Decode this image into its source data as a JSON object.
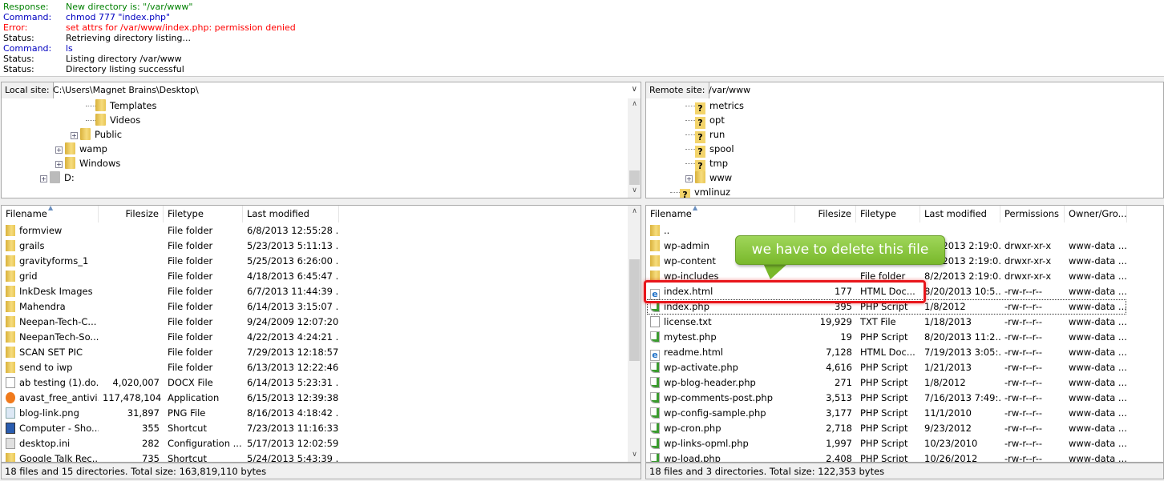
{
  "log": [
    {
      "k": "Response:",
      "v": "New directory is: \"/var/www\"",
      "color": "#008000"
    },
    {
      "k": "Command:",
      "v": "chmod 777 \"index.php\"",
      "color": "#0000c0"
    },
    {
      "k": "Error:",
      "v": "set attrs for /var/www/index.php: permission denied",
      "color": "#ff0000"
    },
    {
      "k": "Status:",
      "v": "Retrieving directory listing...",
      "color": "#000000"
    },
    {
      "k": "Command:",
      "v": "ls",
      "color": "#0000c0"
    },
    {
      "k": "Status:",
      "v": "Listing directory /var/www",
      "color": "#000000"
    },
    {
      "k": "Status:",
      "v": "Directory listing successful",
      "color": "#000000"
    }
  ],
  "local": {
    "site_label": "Local site:",
    "path": "C:\\Users\\Magnet Brains\\Desktop\\",
    "tree": [
      {
        "label": "Templates",
        "indent": 3,
        "icon": "folder",
        "expand": false
      },
      {
        "label": "Videos",
        "indent": 3,
        "icon": "video-folder",
        "expand": false
      },
      {
        "label": "Public",
        "indent": 2,
        "icon": "folder",
        "expand": true
      },
      {
        "label": "wamp",
        "indent": 1,
        "icon": "folder",
        "expand": true
      },
      {
        "label": "Windows",
        "indent": 1,
        "icon": "folder",
        "expand": true
      },
      {
        "label": "D:",
        "indent": 0,
        "icon": "drive",
        "expand": true
      }
    ],
    "columns": [
      "Filename",
      "Filesize",
      "Filetype",
      "Last modified"
    ],
    "files": [
      [
        "formview",
        "",
        "File folder",
        "6/8/2013 12:55:28 ...",
        "folder"
      ],
      [
        "grails",
        "",
        "File folder",
        "5/23/2013 5:11:13 ...",
        "folder"
      ],
      [
        "gravityforms_1",
        "",
        "File folder",
        "5/25/2013 6:26:00 ...",
        "folder"
      ],
      [
        "grid",
        "",
        "File folder",
        "4/18/2013 6:45:47 ...",
        "folder"
      ],
      [
        "InkDesk Images",
        "",
        "File folder",
        "6/7/2013 11:44:39 ...",
        "folder"
      ],
      [
        "Mahendra",
        "",
        "File folder",
        "6/14/2013 3:15:07 ...",
        "folder"
      ],
      [
        "Neepan-Tech-C...",
        "",
        "File folder",
        "9/24/2009 12:07:20...",
        "folder"
      ],
      [
        "NeepanTech-So...",
        "",
        "File folder",
        "4/22/2013 4:24:21 ...",
        "folder"
      ],
      [
        "SCAN SET PIC",
        "",
        "File folder",
        "7/29/2013 12:18:57...",
        "folder"
      ],
      [
        "send to iwp",
        "",
        "File folder",
        "6/13/2013 12:22:46...",
        "folder"
      ],
      [
        "ab testing (1).do...",
        "4,020,007",
        "DOCX File",
        "6/14/2013 5:23:31 ...",
        "doc"
      ],
      [
        "avast_free_antivi...",
        "117,478,104",
        "Application",
        "6/15/2013 12:39:38...",
        "app"
      ],
      [
        "blog-link.png",
        "31,897",
        "PNG File",
        "8/16/2013 4:18:42 ...",
        "img"
      ],
      [
        "Computer - Sho...",
        "355",
        "Shortcut",
        "7/23/2013 11:16:33...",
        "lnk"
      ],
      [
        "desktop.ini",
        "282",
        "Configuration ...",
        "5/17/2013 12:02:59...",
        "ini"
      ],
      [
        "Google Talk Rec...",
        "735",
        "Shortcut",
        "5/24/2013 5:43:39 ...",
        "folder"
      ]
    ],
    "status": "18 files and 15 directories. Total size: 163,819,110 bytes"
  },
  "remote": {
    "site_label": "Remote site:",
    "path": "/var/www",
    "tree": [
      {
        "label": "metrics",
        "indent": 2,
        "icon": "unknown",
        "expand": false
      },
      {
        "label": "opt",
        "indent": 2,
        "icon": "unknown",
        "expand": false
      },
      {
        "label": "run",
        "indent": 2,
        "icon": "unknown",
        "expand": false
      },
      {
        "label": "spool",
        "indent": 2,
        "icon": "unknown",
        "expand": false
      },
      {
        "label": "tmp",
        "indent": 2,
        "icon": "unknown",
        "expand": false
      },
      {
        "label": "www",
        "indent": 2,
        "icon": "folder",
        "expand": true
      },
      {
        "label": "vmlinuz",
        "indent": 1,
        "icon": "unknown",
        "expand": false
      }
    ],
    "columns": [
      "Filename",
      "Filesize",
      "Filetype",
      "Last modified",
      "Permissions",
      "Owner/Gro..."
    ],
    "files": [
      [
        "..",
        "",
        "",
        "",
        "",
        "",
        "folder"
      ],
      [
        "wp-admin",
        "",
        "File folder",
        "8/2/2013 2:19:0...",
        "drwxr-xr-x",
        "www-data ...",
        "folder"
      ],
      [
        "wp-content",
        "",
        "File folder",
        "8/2/2013 2:19:0...",
        "drwxr-xr-x",
        "www-data ...",
        "folder"
      ],
      [
        "wp-includes",
        "",
        "File folder",
        "8/2/2013 2:19:0...",
        "drwxr-xr-x",
        "www-data ...",
        "folder"
      ],
      [
        "index.html",
        "177",
        "HTML Doc...",
        "8/20/2013 10:5...",
        "-rw-r--r--",
        "www-data ...",
        "html"
      ],
      [
        "index.php",
        "395",
        "PHP Script",
        "1/8/2012",
        "-rw-r--r--",
        "www-data ...",
        "php"
      ],
      [
        "license.txt",
        "19,929",
        "TXT File",
        "1/18/2013",
        "-rw-r--r--",
        "www-data ...",
        "doc"
      ],
      [
        "mytest.php",
        "19",
        "PHP Script",
        "8/20/2013 11:2...",
        "-rw-r--r--",
        "www-data ...",
        "php"
      ],
      [
        "readme.html",
        "7,128",
        "HTML Doc...",
        "7/19/2013 3:05:...",
        "-rw-r--r--",
        "www-data ...",
        "html"
      ],
      [
        "wp-activate.php",
        "4,616",
        "PHP Script",
        "1/21/2013",
        "-rw-r--r--",
        "www-data ...",
        "php"
      ],
      [
        "wp-blog-header.php",
        "271",
        "PHP Script",
        "1/8/2012",
        "-rw-r--r--",
        "www-data ...",
        "php"
      ],
      [
        "wp-comments-post.php",
        "3,513",
        "PHP Script",
        "7/16/2013 7:49:...",
        "-rw-r--r--",
        "www-data ...",
        "php"
      ],
      [
        "wp-config-sample.php",
        "3,177",
        "PHP Script",
        "11/1/2010",
        "-rw-r--r--",
        "www-data ...",
        "php"
      ],
      [
        "wp-cron.php",
        "2,718",
        "PHP Script",
        "9/23/2012",
        "-rw-r--r--",
        "www-data ...",
        "php"
      ],
      [
        "wp-links-opml.php",
        "1,997",
        "PHP Script",
        "10/23/2010",
        "-rw-r--r--",
        "www-data ...",
        "php"
      ],
      [
        "wp-load.php",
        "2,408",
        "PHP Script",
        "10/26/2012",
        "-rw-r--r--",
        "www-data ...",
        "php"
      ]
    ],
    "status": "18 files and 3 directories. Total size: 122,353 bytes"
  },
  "annotation": {
    "text": "we have to delete this file",
    "bubble_color": "#8cc63f",
    "highlight_color": "#e8161b"
  }
}
